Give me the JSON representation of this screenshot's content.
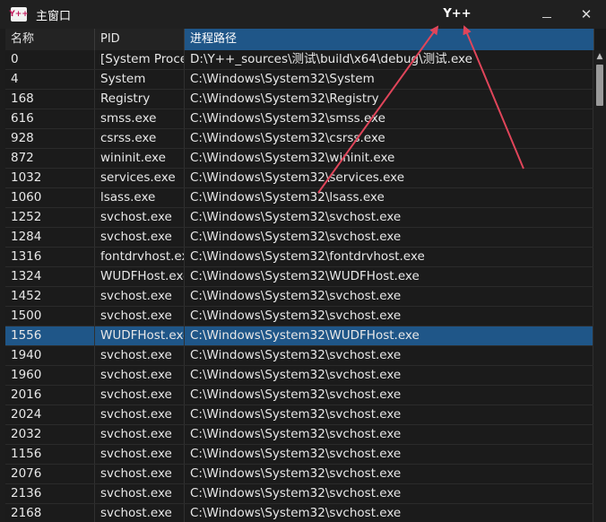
{
  "window": {
    "title": "主窗口",
    "icon_text": "Y++",
    "center_title": "Y++",
    "minimize_glyph": "—",
    "close_glyph": "✕"
  },
  "table": {
    "columns": [
      "名称",
      "PID",
      "进程路径"
    ],
    "sorted_column": 2,
    "selected_row": 14,
    "rows": [
      [
        "0",
        "[System Process]",
        "D:\\Y++_sources\\测试\\build\\x64\\debug\\测试.exe"
      ],
      [
        "4",
        "System",
        "C:\\Windows\\System32\\System"
      ],
      [
        "168",
        "Registry",
        "C:\\Windows\\System32\\Registry"
      ],
      [
        "616",
        "smss.exe",
        "C:\\Windows\\System32\\smss.exe"
      ],
      [
        "928",
        "csrss.exe",
        "C:\\Windows\\System32\\csrss.exe"
      ],
      [
        "872",
        "wininit.exe",
        "C:\\Windows\\System32\\wininit.exe"
      ],
      [
        "1032",
        "services.exe",
        "C:\\Windows\\System32\\services.exe"
      ],
      [
        "1060",
        "lsass.exe",
        "C:\\Windows\\System32\\lsass.exe"
      ],
      [
        "1252",
        "svchost.exe",
        "C:\\Windows\\System32\\svchost.exe"
      ],
      [
        "1284",
        "svchost.exe",
        "C:\\Windows\\System32\\svchost.exe"
      ],
      [
        "1316",
        "fontdrvhost.exe",
        "C:\\Windows\\System32\\fontdrvhost.exe"
      ],
      [
        "1324",
        "WUDFHost.exe",
        "C:\\Windows\\System32\\WUDFHost.exe"
      ],
      [
        "1452",
        "svchost.exe",
        "C:\\Windows\\System32\\svchost.exe"
      ],
      [
        "1500",
        "svchost.exe",
        "C:\\Windows\\System32\\svchost.exe"
      ],
      [
        "1556",
        "WUDFHost.exe",
        "C:\\Windows\\System32\\WUDFHost.exe"
      ],
      [
        "1940",
        "svchost.exe",
        "C:\\Windows\\System32\\svchost.exe"
      ],
      [
        "1960",
        "svchost.exe",
        "C:\\Windows\\System32\\svchost.exe"
      ],
      [
        "2016",
        "svchost.exe",
        "C:\\Windows\\System32\\svchost.exe"
      ],
      [
        "2024",
        "svchost.exe",
        "C:\\Windows\\System32\\svchost.exe"
      ],
      [
        "2032",
        "svchost.exe",
        "C:\\Windows\\System32\\svchost.exe"
      ],
      [
        "1156",
        "svchost.exe",
        "C:\\Windows\\System32\\svchost.exe"
      ],
      [
        "2076",
        "svchost.exe",
        "C:\\Windows\\System32\\svchost.exe"
      ],
      [
        "2136",
        "svchost.exe",
        "C:\\Windows\\System32\\svchost.exe"
      ],
      [
        "2168",
        "svchost.exe",
        "C:\\Windows\\System32\\svchost.exe"
      ]
    ]
  },
  "colors": {
    "selection": "#1f5688",
    "annotation_arrow": "#e0455a"
  }
}
